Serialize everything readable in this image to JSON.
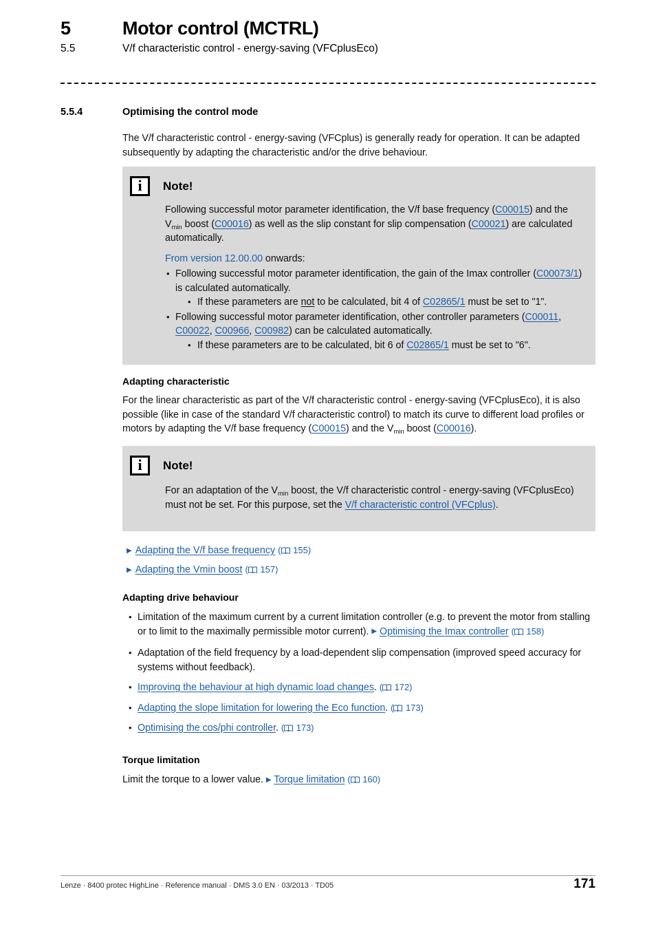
{
  "header": {
    "chapter_number": "5",
    "chapter_title": "Motor control (MCTRL)",
    "section_number": "5.5",
    "section_title": "V/f characteristic control - energy-saving (VFCplusEco)"
  },
  "subsection": {
    "number": "5.5.4",
    "title": "Optimising the control mode"
  },
  "intro": "The V/f characteristic control - energy-saving (VFCplus) is generally ready for operation. It can be adapted subsequently by adapting the characteristic and/or the drive behaviour.",
  "note1": {
    "icon": "info-icon",
    "title": "Note!",
    "para1_a": "Following successful motor parameter identification, the V/f base frequency (",
    "link_c00015": "C00015",
    "para1_b": ") and the V",
    "sub_min": "min",
    "para1_c": " boost (",
    "link_c00016": "C00016",
    "para1_d": ") as well as the slip constant for slip compensation (",
    "link_c00021": "C00021",
    "para1_e": ") are calculated automatically.",
    "version_blue": "From version 12.00.00",
    "version_rest": " onwards:",
    "bullets": [
      {
        "text_a": "Following successful motor parameter identification, the gain of the Imax controller (",
        "link": "C00073/1",
        "text_b": ") is calculated automatically.",
        "sub_a": "If these parameters are ",
        "sub_underline": "not",
        "sub_b": " to be calculated, bit 4 of ",
        "sub_link": "C02865/1",
        "sub_c": " must be set to \"1\"."
      },
      {
        "text_a": "Following successful motor parameter identification, other controller parameters (",
        "link1": "C00011",
        "sep1": ", ",
        "link2": "C00022",
        "sep2": ", ",
        "link3": "C00966",
        "sep3": ", ",
        "link4": "C00982",
        "text_b": ") can be calculated automatically.",
        "sub_a": "If these parameters are to be calculated, bit 6 of ",
        "sub_link": "C02865/1",
        "sub_c": " must be set to \"6\"."
      }
    ]
  },
  "adapting_characteristic": {
    "heading": "Adapting characteristic",
    "para_a": "For the linear characteristic as part of the V/f characteristic control - energy-saving (VFCplusEco), it is also possible (like in case of the standard V/f characteristic control) to match its curve to different load profiles or motors by adapting the V/f base frequency (",
    "link_c00015": "C00015",
    "para_b": ") and the V",
    "sub_min": "min",
    "para_c": " boost (",
    "link_c00016": "C00016",
    "para_d": ")."
  },
  "note2": {
    "icon": "info-icon",
    "title": "Note!",
    "text_a": "For an adaptation of the V",
    "sub_min": "min",
    "text_b": " boost, the V/f characteristic control - energy-saving (VFCplusEco) must not be set. For this purpose, set the ",
    "link": "V/f characteristic control (VFCplus)",
    "text_c": "."
  },
  "xrefs": [
    {
      "icon": "triangle-right-icon",
      "label": "Adapting the V/f base frequency",
      "page_icon": "book-icon",
      "page": "155"
    },
    {
      "icon": "triangle-right-icon",
      "label": "Adapting the Vmin boost",
      "page_icon": "book-icon",
      "page": "157"
    }
  ],
  "adapting_drive": {
    "heading": "Adapting drive behaviour",
    "items": [
      {
        "text_a": "Limitation of the maximum current by a current limitation controller (e.g. to prevent the motor from stalling or to limit to the maximally permissible motor current). ",
        "tri": "triangle-right-icon",
        "link": "Optimising the Imax controller",
        "page_icon": "book-icon",
        "page": "158"
      },
      {
        "text_a": "Adaptation of the field frequency by a load-dependent slip compensation (improved speed accuracy for systems without feedback)."
      },
      {
        "link": "Improving the behaviour at high dynamic load changes",
        "text_b": ". ",
        "page_icon": "book-icon",
        "page": "172"
      },
      {
        "link": "Adapting the slope limitation for lowering the Eco function",
        "text_b": ". ",
        "page_icon": "book-icon",
        "page": "173"
      },
      {
        "link": "Optimising the cos/phi controller",
        "text_b": ". ",
        "page_icon": "book-icon",
        "page": "173"
      }
    ]
  },
  "torque": {
    "heading": "Torque limitation",
    "text_a": "Limit the torque to a lower value. ",
    "tri": "triangle-right-icon",
    "link": "Torque limitation",
    "page_icon": "book-icon",
    "page": "160"
  },
  "footer": {
    "left": "Lenze · 8400 protec HighLine · Reference manual · DMS 3.0 EN · 03/2013 · TD05",
    "page_number": "171"
  },
  "colors": {
    "link": "#1f5fa8",
    "note_bg": "#d9d9d9",
    "text": "#111111"
  }
}
